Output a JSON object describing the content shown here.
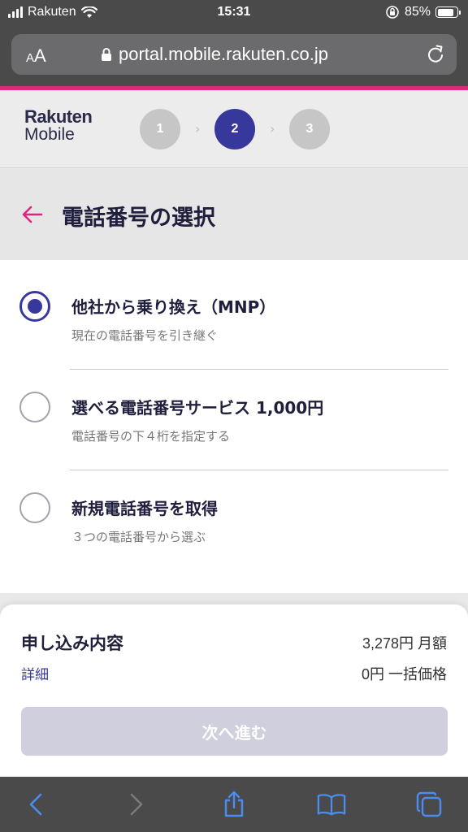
{
  "status_bar": {
    "carrier": "Rakuten",
    "time": "15:31",
    "battery": "85%",
    "battery_level": 0.85
  },
  "browser": {
    "aa_label_big": "A",
    "aa_label_small": "A",
    "url": "portal.mobile.rakuten.co.jp"
  },
  "header": {
    "logo_line1": "Rakuten",
    "logo_line2": "Mobile",
    "steps": [
      "1",
      "2",
      "3"
    ],
    "active_step": 2
  },
  "page": {
    "title": "電話番号の選択"
  },
  "options": [
    {
      "title": "他社から乗り換え（MNP）",
      "subtitle": "現在の電話番号を引き継ぐ",
      "checked": true
    },
    {
      "title": "選べる電話番号サービス 1,000円",
      "subtitle": "電話番号の下４桁を指定する",
      "checked": false
    },
    {
      "title": "新規電話番号を取得",
      "subtitle": "３つの電話番号から選ぶ",
      "checked": false
    }
  ],
  "summary": {
    "title": "申し込み内容",
    "detail_link": "詳細",
    "monthly": "3,278円 月額",
    "one_time": "0円 一括価格",
    "next_button": "次へ進む"
  },
  "colors": {
    "accent_pink": "#e0267d",
    "brand_indigo": "#37389b",
    "toolbar_icon": "#4a8cf0"
  }
}
